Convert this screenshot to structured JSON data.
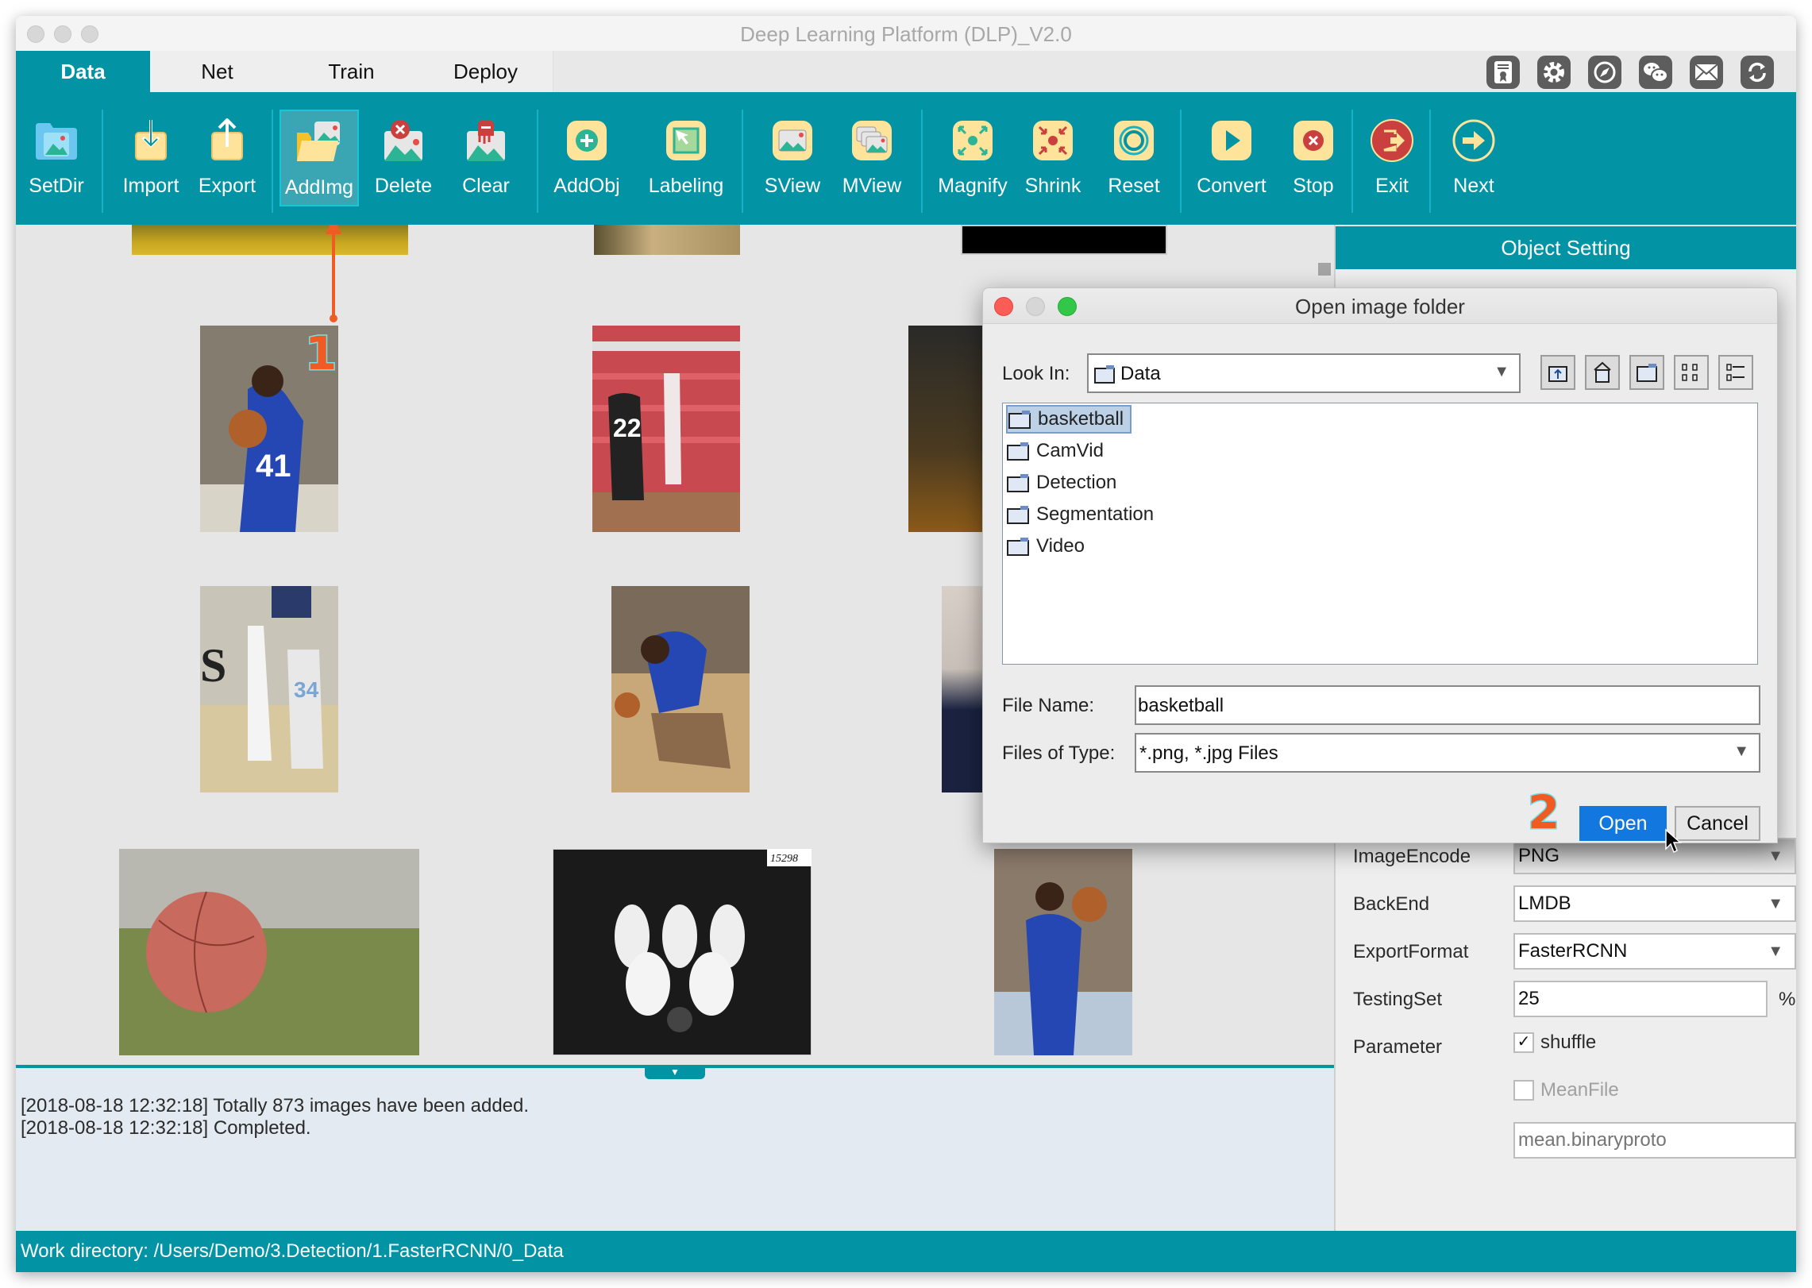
{
  "window": {
    "title": "Deep Learning Platform (DLP)_V2.0"
  },
  "tabs": [
    {
      "label": "Data",
      "active": true
    },
    {
      "label": "Net",
      "active": false
    },
    {
      "label": "Train",
      "active": false
    },
    {
      "label": "Deploy",
      "active": false
    }
  ],
  "top_icons": [
    "certificate-icon",
    "gear-icon",
    "compass-icon",
    "wechat-icon",
    "mail-icon",
    "refresh-icon"
  ],
  "toolbar": [
    {
      "label": "SetDir",
      "icon": "folder-image-icon"
    },
    {
      "label": "Import",
      "icon": "import-icon"
    },
    {
      "label": "Export",
      "icon": "export-icon"
    },
    {
      "label": "AddImg",
      "icon": "add-image-folder-icon",
      "active": true
    },
    {
      "label": "Delete",
      "icon": "delete-image-icon"
    },
    {
      "label": "Clear",
      "icon": "clear-image-icon"
    },
    {
      "label": "AddObj",
      "icon": "add-object-icon"
    },
    {
      "label": "Labeling",
      "icon": "labeling-cursor-icon"
    },
    {
      "label": "SView",
      "icon": "single-view-icon"
    },
    {
      "label": "MView",
      "icon": "multi-view-icon"
    },
    {
      "label": "Magnify",
      "icon": "magnify-icon"
    },
    {
      "label": "Shrink",
      "icon": "shrink-icon"
    },
    {
      "label": "Reset",
      "icon": "reset-icon"
    },
    {
      "label": "Convert",
      "icon": "play-icon"
    },
    {
      "label": "Stop",
      "icon": "stop-icon"
    },
    {
      "label": "Exit",
      "icon": "exit-icon"
    },
    {
      "label": "Next",
      "icon": "next-arrow-icon"
    }
  ],
  "thumbnails": [
    {
      "desc": "basketball court floor (partial)"
    },
    {
      "desc": "player shoes on court (partial)"
    },
    {
      "desc": "black image (partial)"
    },
    {
      "desc": "player #41 in blue holding ball"
    },
    {
      "desc": "player #22 and shooter in red gym"
    },
    {
      "desc": "arena crowd (partial)"
    },
    {
      "desc": "women shooting, #34"
    },
    {
      "desc": "player in blue dribbling"
    },
    {
      "desc": "hoop and net (partial)"
    },
    {
      "desc": "basketball on grass"
    },
    {
      "desc": "vintage team photo"
    },
    {
      "desc": "player in blue shooting free throw"
    }
  ],
  "annotations": {
    "step1": "1",
    "step2": "2"
  },
  "object_setting": {
    "title": "Object Setting",
    "fields": [
      {
        "label": "ImageEncode",
        "value": "PNG",
        "type": "select"
      },
      {
        "label": "BackEnd",
        "value": "LMDB",
        "type": "select"
      },
      {
        "label": "ExportFormat",
        "value": "FasterRCNN",
        "type": "select"
      },
      {
        "label": "TestingSet",
        "value": "25",
        "unit": "%",
        "type": "text"
      }
    ],
    "parameter_label": "Parameter",
    "shuffle": {
      "label": "shuffle",
      "checked": true
    },
    "meanfile": {
      "label": "MeanFile",
      "checked": false,
      "enabled": false
    },
    "meanfile_path": {
      "placeholder": "mean.binaryproto"
    }
  },
  "log": {
    "lines": [
      "[2018-08-18 12:32:18] Totally 873 images have been added.",
      "[2018-08-18 12:32:18] Completed."
    ]
  },
  "status": {
    "work_directory": "Work directory: /Users/Demo/3.Detection/1.FasterRCNN/0_Data"
  },
  "dialog": {
    "title": "Open image folder",
    "look_in_label": "Look In:",
    "look_in_value": "Data",
    "tool_icons": [
      "up-folder-icon",
      "home-icon",
      "new-folder-icon",
      "list-view-icon",
      "details-view-icon"
    ],
    "folders": [
      {
        "name": "basketball",
        "selected": true
      },
      {
        "name": "CamVid",
        "selected": false
      },
      {
        "name": "Detection",
        "selected": false
      },
      {
        "name": "Segmentation",
        "selected": false
      },
      {
        "name": "Video",
        "selected": false
      }
    ],
    "file_name_label": "File Name:",
    "file_name_value": "basketball",
    "files_of_type_label": "Files of Type:",
    "files_of_type_value": "*.png, *.jpg Files",
    "open_label": "Open",
    "cancel_label": "Cancel"
  }
}
